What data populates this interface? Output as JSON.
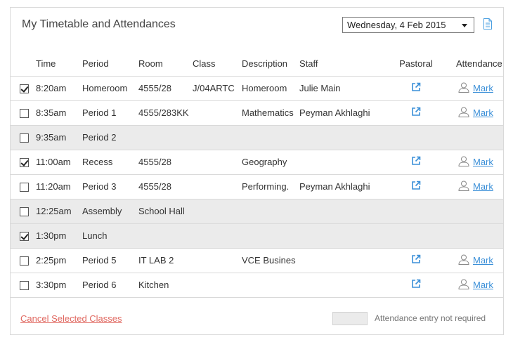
{
  "header": {
    "title": "My Timetable and Attendances",
    "date": "Wednesday, 4 Feb 2015"
  },
  "columns": {
    "time": "Time",
    "period": "Period",
    "room": "Room",
    "class": "Class",
    "description": "Description",
    "staff": "Staff",
    "pastoral": "Pastoral",
    "attendance": "Attendance"
  },
  "rows": [
    {
      "checked": true,
      "shaded": false,
      "time": "8:20am",
      "period": "Homeroom",
      "room": "4555/28",
      "class": "J/04ARTC",
      "description": "Homeroom",
      "staff": "Julie Main",
      "pastoral": true,
      "mark": "Mark"
    },
    {
      "checked": false,
      "shaded": false,
      "time": "8:35am",
      "period": "Period 1",
      "room": "4555/283KK",
      "class": "",
      "description": "Mathematics",
      "staff": "Peyman Akhlaghi",
      "pastoral": true,
      "mark": "Mark"
    },
    {
      "checked": false,
      "shaded": true,
      "time": "9:35am",
      "period": "Period 2",
      "room": "",
      "class": "",
      "description": "",
      "staff": "",
      "pastoral": false,
      "mark": ""
    },
    {
      "checked": true,
      "shaded": false,
      "time": "11:00am",
      "period": "Recess",
      "room": "4555/28",
      "class": "",
      "description": "Geography",
      "staff": "",
      "pastoral": true,
      "mark": "Mark"
    },
    {
      "checked": false,
      "shaded": false,
      "time": "11:20am",
      "period": "Period 3",
      "room": "4555/28",
      "class": "",
      "description": "Performing.",
      "staff": "Peyman Akhlaghi",
      "pastoral": true,
      "mark": "Mark"
    },
    {
      "checked": false,
      "shaded": true,
      "time": "12:25am",
      "period": "Assembly",
      "room": "School Hall",
      "class": "",
      "description": "",
      "staff": "",
      "pastoral": false,
      "mark": ""
    },
    {
      "checked": true,
      "shaded": true,
      "time": "1:30pm",
      "period": "Lunch",
      "room": "",
      "class": "",
      "description": "",
      "staff": "",
      "pastoral": false,
      "mark": ""
    },
    {
      "checked": false,
      "shaded": false,
      "time": "2:25pm",
      "period": "Period 5",
      "room": "IT LAB 2",
      "class": "",
      "description": "VCE Busines",
      "staff": "",
      "pastoral": true,
      "mark": "Mark"
    },
    {
      "checked": false,
      "shaded": false,
      "time": "3:30pm",
      "period": "Period 6",
      "room": "Kitchen",
      "class": "",
      "description": "",
      "staff": "",
      "pastoral": true,
      "mark": "Mark"
    }
  ],
  "footer": {
    "cancel_label": "Cancel Selected Classes",
    "legend_text": "Attendance entry not required"
  },
  "colors": {
    "link": "#3a8fd8",
    "cancel": "#e0675f",
    "shaded_row": "#ebebeb"
  },
  "icons": {
    "pastoral": "external-link-icon",
    "attendance": "person-icon",
    "header_action": "document-icon"
  }
}
